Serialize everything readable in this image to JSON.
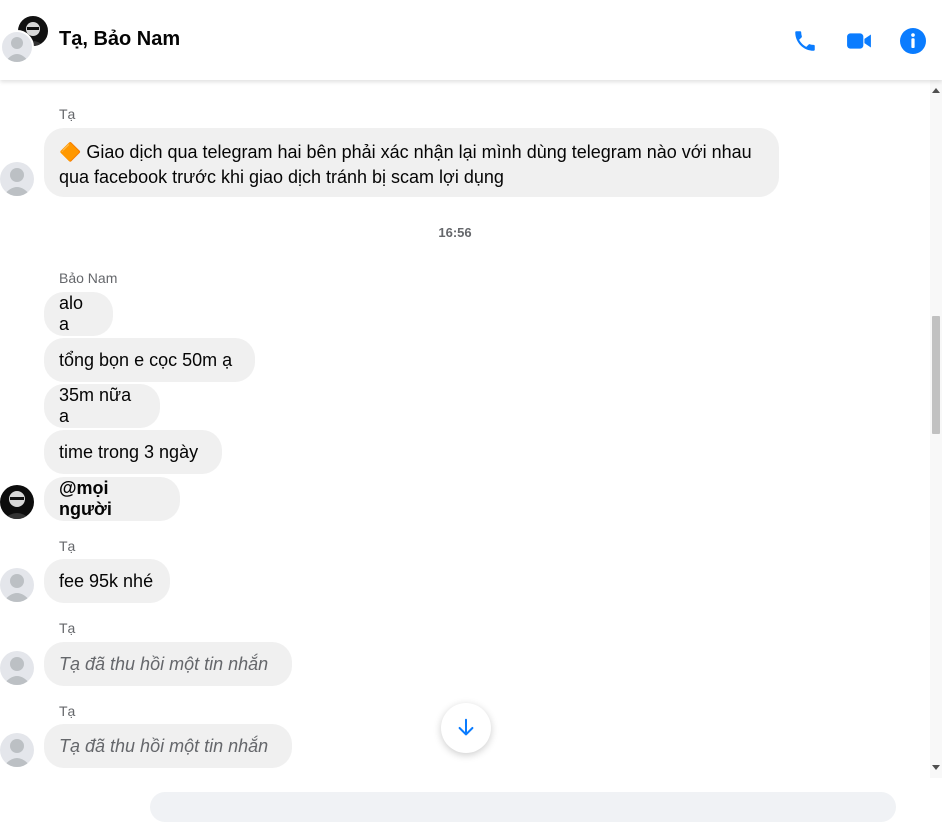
{
  "header": {
    "title": "Tạ, Bảo Nam",
    "icons": [
      "phone-icon",
      "video-icon",
      "info-icon"
    ],
    "accent": "#0a7cff"
  },
  "messages": [
    {
      "sender": "Tạ",
      "text": "🔶 Giao dịch qua telegram hai bên phải xác nhận lại mình dùng telegram nào với nhau qua facebook trước khi giao dịch tránh bị scam lợi dụng"
    },
    {
      "timestamp": "16:56"
    },
    {
      "sender": "Bảo Nam",
      "texts": [
        "alo a",
        "tổng bọn e cọc 50m ạ",
        "35m nữa a",
        "time trong 3 ngày",
        "@mọi người"
      ]
    },
    {
      "sender": "Tạ",
      "text": "fee 95k nhé"
    },
    {
      "sender": "Tạ",
      "text": "Tạ đã thu hồi một tin nhắn"
    },
    {
      "sender": "Tạ",
      "text": "Tạ đã thu hồi một tin nhắn"
    }
  ],
  "colors": {
    "bubble": "#f0f0f0",
    "secondary_text": "#65676b",
    "accent": "#0a7cff"
  }
}
